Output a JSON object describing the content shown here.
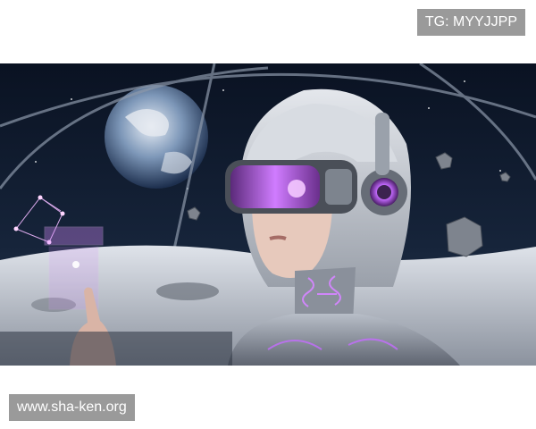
{
  "watermarks": {
    "top_right": "TG: MYYJJPP",
    "bottom_left": "www.sha-ken.org"
  },
  "image": {
    "subject": "silver-haired cyborg woman wearing purple-glowing VR visor and headphones, touching a holographic panel, inside a glass dome on a lunar surface with Earth and floating asteroids",
    "colors": {
      "space": "#0b1424",
      "glow": "#c46bff",
      "hair": "#c9cdd4",
      "moon_ground": "#cfd3da"
    }
  }
}
